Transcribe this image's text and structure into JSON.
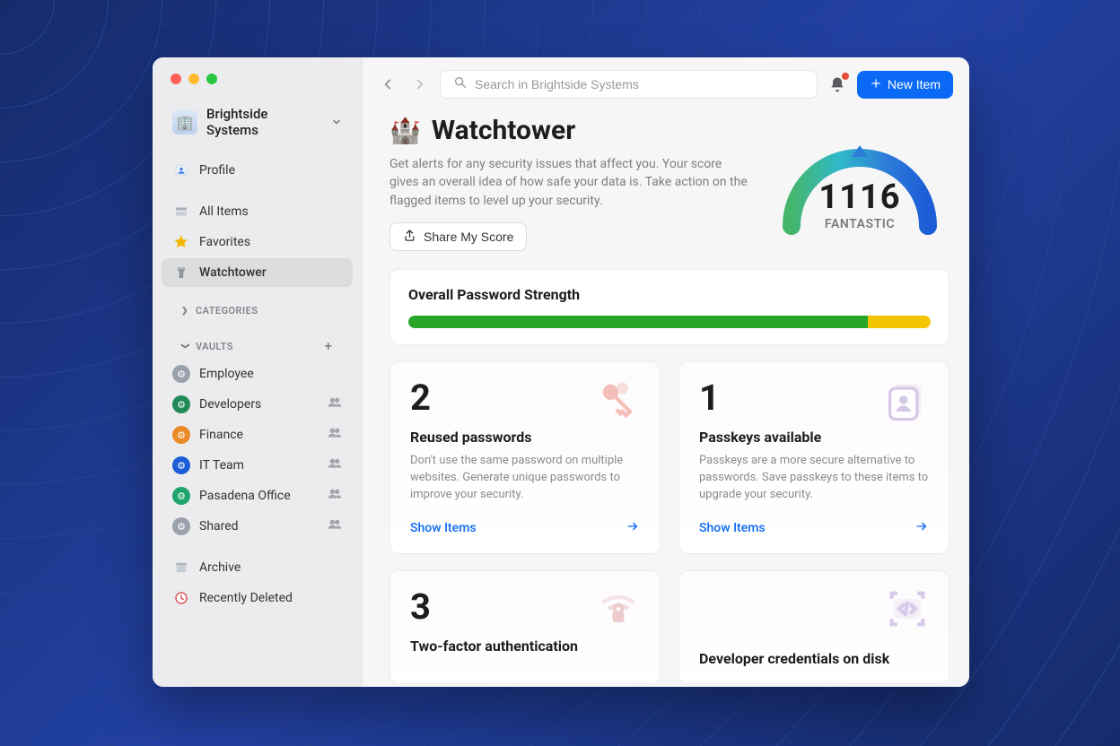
{
  "account": {
    "name": "Brightside Systems",
    "logo_glyph": "🏢"
  },
  "sidebar": {
    "profile_label": "Profile",
    "items": [
      {
        "label": "All Items"
      },
      {
        "label": "Favorites"
      },
      {
        "label": "Watchtower",
        "active": true
      }
    ],
    "categories_label": "CATEGORIES",
    "vaults_label": "VAULTS",
    "vaults": [
      {
        "label": "Employee",
        "shared": false
      },
      {
        "label": "Developers",
        "shared": true
      },
      {
        "label": "Finance",
        "shared": true
      },
      {
        "label": "IT Team",
        "shared": true
      },
      {
        "label": "Pasadena Office",
        "shared": true
      },
      {
        "label": "Shared",
        "shared": true
      }
    ],
    "archive_label": "Archive",
    "recently_deleted_label": "Recently Deleted"
  },
  "toolbar": {
    "search_placeholder": "Search in Brightside Systems",
    "new_item_label": "New Item"
  },
  "page": {
    "title": "Watchtower",
    "title_glyph": "🏰",
    "description": "Get alerts for any security issues that affect you. Your score gives an overall idea of how safe your data is. Take action on the flagged items to level up your security.",
    "share_label": "Share My Score",
    "score": {
      "value": "1116",
      "label": "FANTASTIC"
    }
  },
  "strength": {
    "title": "Overall Password Strength",
    "green_pct": 88,
    "yellow_pct": 12
  },
  "metrics": {
    "reused": {
      "count": "2",
      "title": "Reused passwords",
      "desc": "Don't use the same password on multiple websites. Generate unique passwords to improve your security.",
      "link": "Show Items"
    },
    "passkeys": {
      "count": "1",
      "title": "Passkeys available",
      "desc": "Passkeys are a more secure alternative to passwords. Save passkeys to these items to upgrade your security.",
      "link": "Show Items"
    },
    "twofa": {
      "count": "3",
      "title": "Two-factor authentication"
    },
    "dev": {
      "title": "Developer credentials on disk"
    }
  }
}
